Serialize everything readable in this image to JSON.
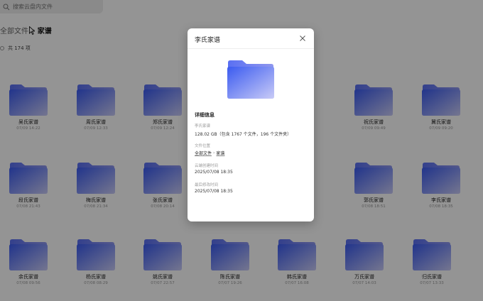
{
  "search": {
    "placeholder": "搜索云盘内文件"
  },
  "breadcrumb": {
    "root": "全部文件",
    "separator": ">",
    "current": "家谱"
  },
  "summary": {
    "count_text": "共 174 项"
  },
  "folders": [
    {
      "name": "吴氏家谱",
      "date": "07/09 14:22"
    },
    {
      "name": "周氏家谱",
      "date": "07/09 12:33"
    },
    {
      "name": "郑氏家谱",
      "date": "07/09 12:24"
    },
    {
      "name": "祝氏家谱",
      "date": "07/09 09:49"
    },
    {
      "name": "冀氏家谱",
      "date": "07/09 09:20"
    },
    {
      "name": "段氏家谱",
      "date": "07/08 21:43"
    },
    {
      "name": "梅氏家谱",
      "date": "07/08 21:34"
    },
    {
      "name": "张氏家谱",
      "date": "07/08 20:14"
    },
    {
      "name": "郭氏家谱",
      "date": "07/08 18:51"
    },
    {
      "name": "李氏家谱",
      "date": "07/08 18:35"
    },
    {
      "name": "余氏家谱",
      "date": "07/08 09:56"
    },
    {
      "name": "杨氏家谱",
      "date": "07/08 08:29"
    },
    {
      "name": "姚氏家谱",
      "date": "07/07 22:57"
    },
    {
      "name": "陈氏家谱",
      "date": "07/07 19:26"
    },
    {
      "name": "韩氏家谱",
      "date": "07/07 16:08"
    },
    {
      "name": "万氏家谱",
      "date": "07/07 14:03"
    },
    {
      "name": "归氏家谱",
      "date": "07/07 13:33"
    }
  ],
  "modal": {
    "title": "李氏家谱",
    "section_title": "详细信息",
    "name_label": "李氏家谱",
    "size_value": "128.02 GB（包含 1767 个文件，196 个文件夹）",
    "location_label": "文件位置",
    "location_root": "全部文件",
    "location_arrow": "›",
    "location_folder": "家谱",
    "created_label": "云端创建时间",
    "created_value": "2025/07/08 18:35",
    "modified_label": "最后修改时间",
    "modified_value": "2025/07/08 18:35"
  },
  "colors": {
    "folder_front_start": "#3d63f0",
    "folder_front_end": "#c7cbf6",
    "folder_back": "#5b6ef0",
    "overlay": "rgba(0,0,0,0.42)"
  },
  "icons": {
    "search": "search-icon",
    "close": "close-icon",
    "folder": "folder-icon",
    "cursor": "cursor-icon"
  }
}
